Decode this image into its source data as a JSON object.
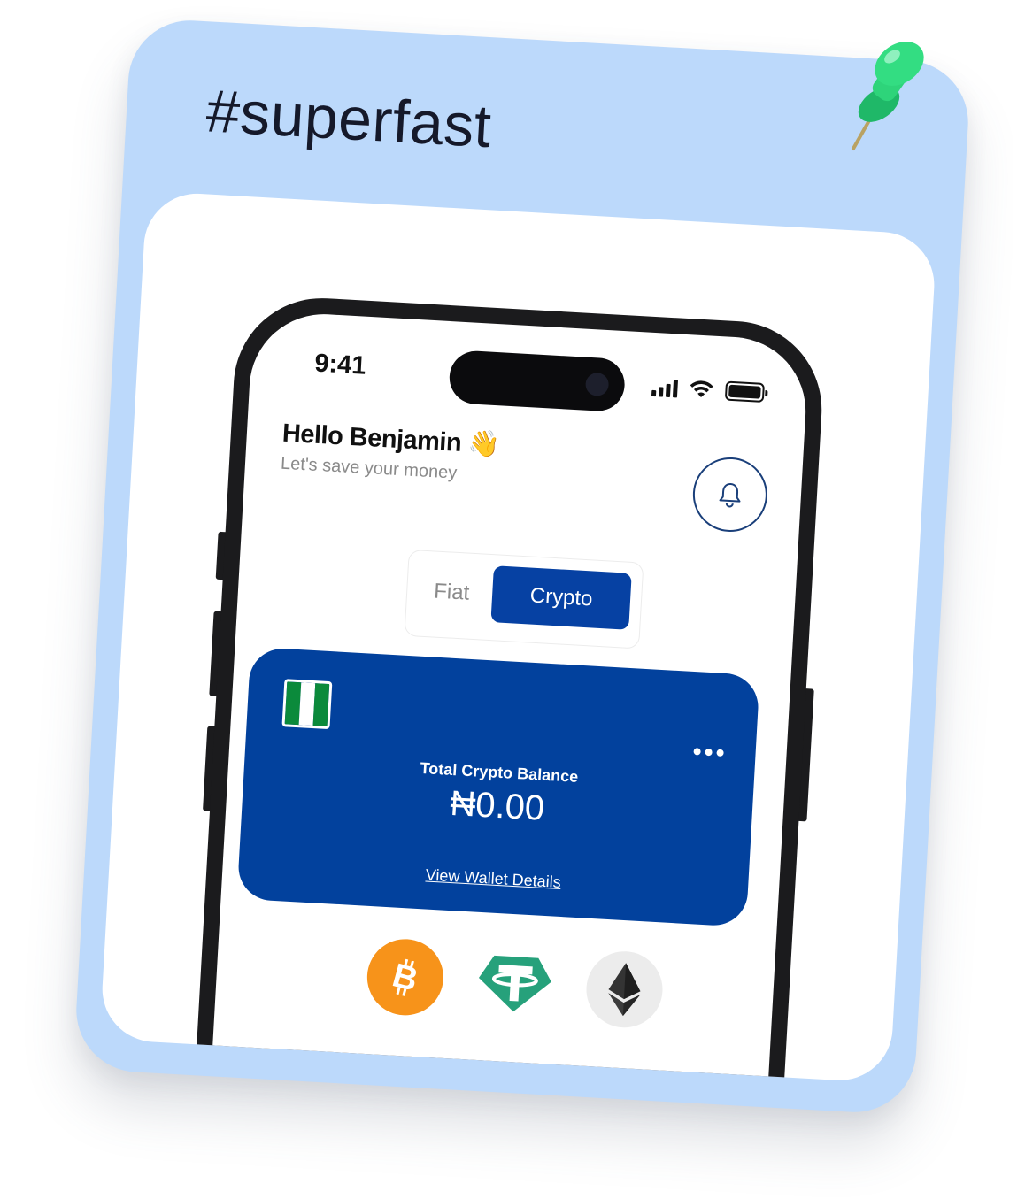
{
  "card": {
    "hashtag": "#superfast"
  },
  "status_bar": {
    "time": "9:41"
  },
  "greeting": {
    "title": "Hello Benjamin",
    "emoji": "👋",
    "subtitle": "Let's save your money"
  },
  "toggle": {
    "options": [
      "Fiat",
      "Crypto"
    ],
    "selected": "Crypto"
  },
  "balance": {
    "label": "Total Crypto Balance",
    "amount": "₦0.00",
    "link": "View Wallet Details"
  },
  "coins": [
    {
      "name": "bitcoin-icon",
      "color": "#f7931a"
    },
    {
      "name": "tether-icon",
      "color": "#26a17b"
    },
    {
      "name": "ethereum-icon",
      "color": "#ececec"
    }
  ],
  "colors": {
    "card_bg": "#bcd9fb",
    "accent": "#02419d",
    "pin": "#2ed47a"
  }
}
